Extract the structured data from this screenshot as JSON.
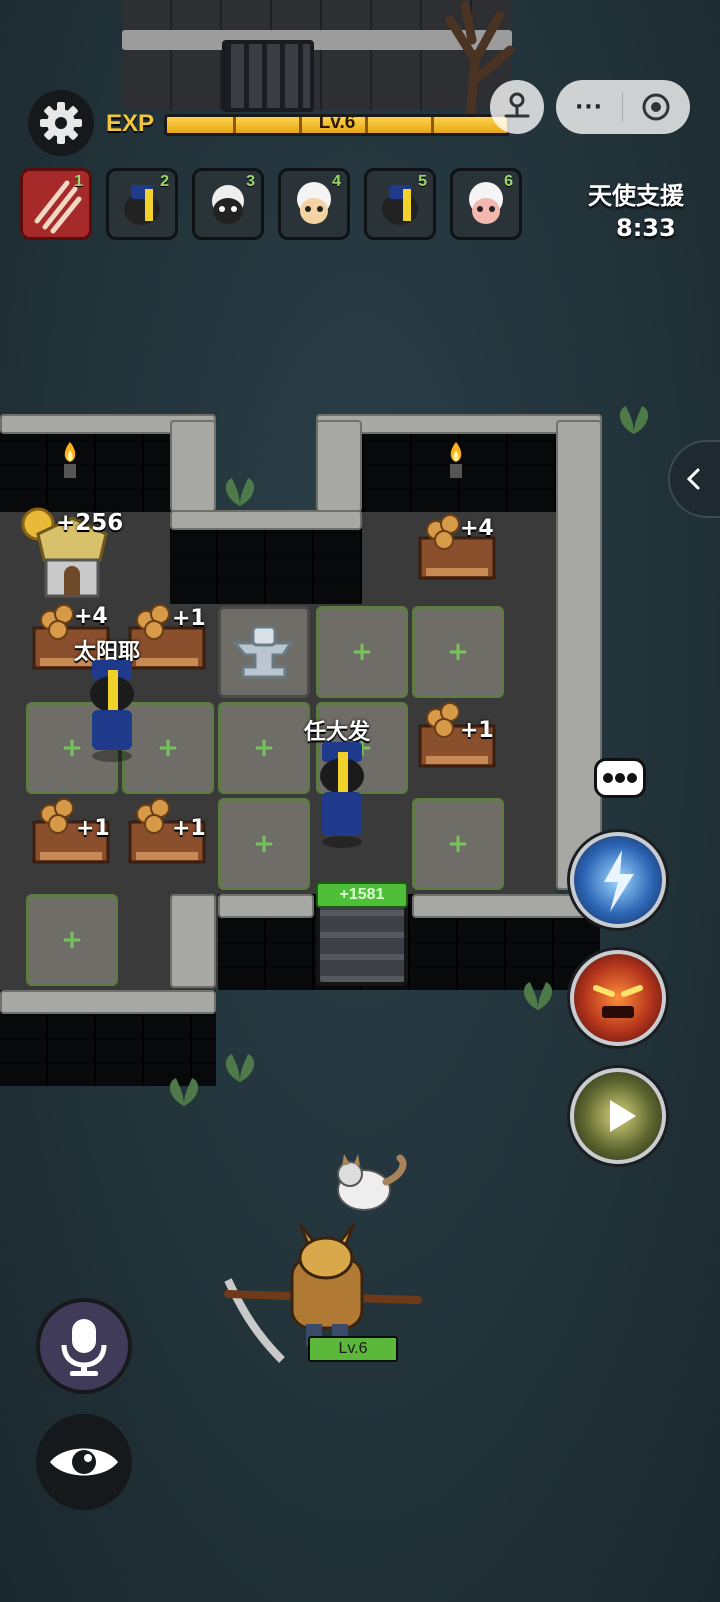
{
  "hud": {
    "exp_label": "EXP",
    "level_text": "Lv.6",
    "exp_progress": 0.92
  },
  "mini_program": {
    "more_label": "···"
  },
  "unit_slots": [
    {
      "num": "1",
      "kind": "claw-skill"
    },
    {
      "num": "2",
      "kind": "jiangshi-sheep"
    },
    {
      "num": "3",
      "kind": "dark-sheep"
    },
    {
      "num": "4",
      "kind": "white-sheep"
    },
    {
      "num": "5",
      "kind": "jiangshi-sheep"
    },
    {
      "num": "6",
      "kind": "pink-sheep"
    }
  ],
  "angel_support": {
    "title": "天使支援",
    "timer": "8:33"
  },
  "map": {
    "gold_bonus": "+256",
    "crate_bonuses": {
      "top_right": "+4",
      "left_1": "+4",
      "left_2": "+1",
      "mid_right": "+1",
      "bottom_left_1": "+1",
      "bottom_left_2": "+1"
    },
    "npc_names": {
      "left": "太阳耶",
      "center": "任大发"
    },
    "gate_hp": "+1581"
  },
  "hero": {
    "level_text": "Lv.6",
    "hp_fraction": 1.0
  },
  "colors": {
    "exp_gold": "#f3c53a",
    "grass_plus": "#78c25b",
    "hp_green": "#5cb83a",
    "active_slot": "#a62a2a"
  }
}
